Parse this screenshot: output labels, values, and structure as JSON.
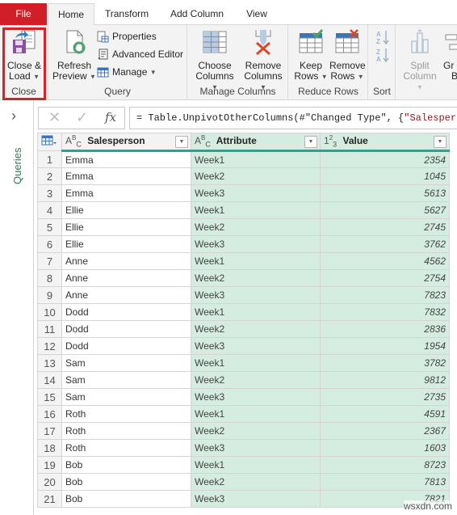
{
  "tabs": [
    {
      "label": "File",
      "active": false
    },
    {
      "label": "Home",
      "active": true
    },
    {
      "label": "Transform",
      "active": false
    },
    {
      "label": "Add Column",
      "active": false
    },
    {
      "label": "View",
      "active": false
    }
  ],
  "ribbon": {
    "close_group": {
      "label": "Close",
      "close_load": {
        "line1": "Close &",
        "line2": "Load"
      }
    },
    "query_group": {
      "label": "Query",
      "refresh": {
        "line1": "Refresh",
        "line2": "Preview"
      },
      "properties": "Properties",
      "advanced_editor": "Advanced Editor",
      "manage": "Manage"
    },
    "manage_columns_group": {
      "label": "Manage Columns",
      "choose": {
        "line1": "Choose",
        "line2": "Columns"
      },
      "remove": {
        "line1": "Remove",
        "line2": "Columns"
      }
    },
    "reduce_rows_group": {
      "label": "Reduce Rows",
      "keep": {
        "line1": "Keep",
        "line2": "Rows"
      },
      "remove": {
        "line1": "Remove",
        "line2": "Rows"
      }
    },
    "sort_group": {
      "label": "Sort"
    },
    "transform_group": {
      "split": {
        "line1": "Split",
        "line2": "Column"
      },
      "group_by": {
        "line1": "Gr",
        "line2": "B"
      }
    }
  },
  "left_panel": {
    "label": "Queries"
  },
  "formula_bar": {
    "prefix": "= Table.UnpivotOtherColumns(#\"Changed Type\", {",
    "string": "\"Salesperson\"",
    "suffix": "}"
  },
  "table": {
    "columns": [
      {
        "type_icon": "ABC",
        "name": "Salesperson"
      },
      {
        "type_icon": "ABC",
        "name": "Attribute"
      },
      {
        "type_icon": "123",
        "name": "Value"
      }
    ],
    "rows": [
      {
        "n": "1",
        "salesperson": "Emma",
        "attribute": "Week1",
        "value": "2354"
      },
      {
        "n": "2",
        "salesperson": "Emma",
        "attribute": "Week2",
        "value": "1045"
      },
      {
        "n": "3",
        "salesperson": "Emma",
        "attribute": "Week3",
        "value": "5613"
      },
      {
        "n": "4",
        "salesperson": "Ellie",
        "attribute": "Week1",
        "value": "5627"
      },
      {
        "n": "5",
        "salesperson": "Ellie",
        "attribute": "Week2",
        "value": "2745"
      },
      {
        "n": "6",
        "salesperson": "Ellie",
        "attribute": "Week3",
        "value": "3762"
      },
      {
        "n": "7",
        "salesperson": "Anne",
        "attribute": "Week1",
        "value": "4562"
      },
      {
        "n": "8",
        "salesperson": "Anne",
        "attribute": "Week2",
        "value": "2754"
      },
      {
        "n": "9",
        "salesperson": "Anne",
        "attribute": "Week3",
        "value": "7823"
      },
      {
        "n": "10",
        "salesperson": "Dodd",
        "attribute": "Week1",
        "value": "7832"
      },
      {
        "n": "11",
        "salesperson": "Dodd",
        "attribute": "Week2",
        "value": "2836"
      },
      {
        "n": "12",
        "salesperson": "Dodd",
        "attribute": "Week3",
        "value": "1954"
      },
      {
        "n": "13",
        "salesperson": "Sam",
        "attribute": "Week1",
        "value": "3782"
      },
      {
        "n": "14",
        "salesperson": "Sam",
        "attribute": "Week2",
        "value": "9812"
      },
      {
        "n": "15",
        "salesperson": "Sam",
        "attribute": "Week3",
        "value": "2735"
      },
      {
        "n": "16",
        "salesperson": "Roth",
        "attribute": "Week1",
        "value": "4591"
      },
      {
        "n": "17",
        "salesperson": "Roth",
        "attribute": "Week2",
        "value": "2367"
      },
      {
        "n": "18",
        "salesperson": "Roth",
        "attribute": "Week3",
        "value": "1603"
      },
      {
        "n": "19",
        "salesperson": "Bob",
        "attribute": "Week1",
        "value": "8723"
      },
      {
        "n": "20",
        "salesperson": "Bob",
        "attribute": "Week2",
        "value": "7813"
      },
      {
        "n": "21",
        "salesperson": "Bob",
        "attribute": "Week3",
        "value": "7821"
      }
    ]
  },
  "watermark": "wsxdn.com",
  "colors": {
    "file_tab": "#d01f26",
    "highlight": "#e11c22",
    "header_underline": "#13ad9a",
    "selected_column_bg": "#d4ede0"
  }
}
